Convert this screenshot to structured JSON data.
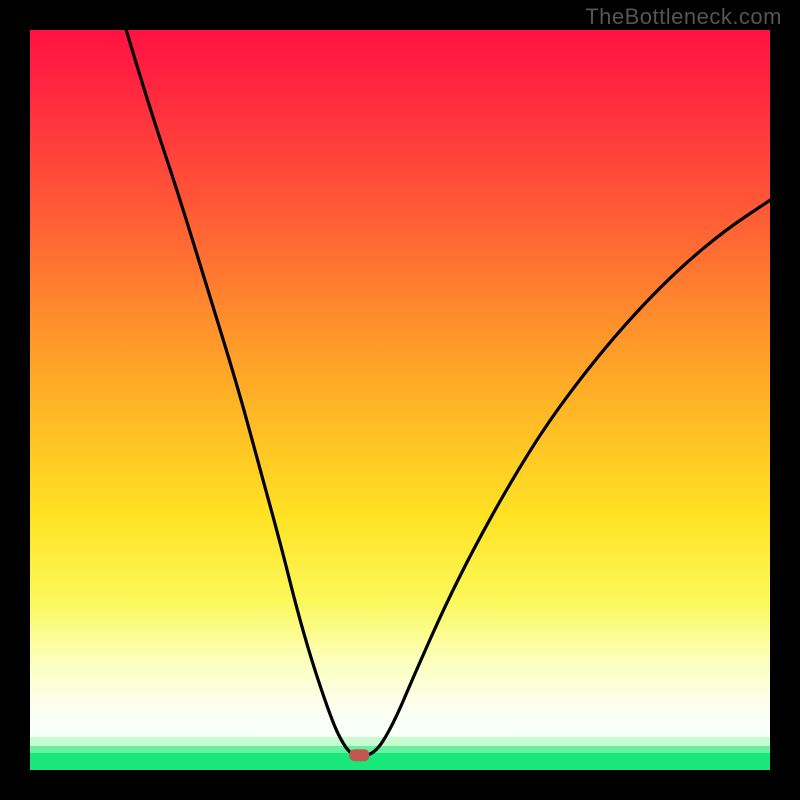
{
  "watermark": "TheBottleneck.com",
  "colors": {
    "frame_bg": "#000000",
    "curve": "#000000",
    "marker": "#c0584e",
    "gradient_top": "#ff1242",
    "gradient_mid": "#ffe223",
    "gradient_green": "#17e879"
  },
  "chart_data": {
    "type": "line",
    "title": "",
    "xlabel": "",
    "ylabel": "",
    "xlim": [
      0,
      100
    ],
    "ylim": [
      0,
      100
    ],
    "grid": false,
    "legend": false,
    "annotations": [
      "TheBottleneck.com"
    ],
    "marker": {
      "x": 44.5,
      "y": 2.0
    },
    "series": [
      {
        "name": "left-branch",
        "x": [
          13,
          16,
          20,
          24,
          28,
          31,
          34,
          36,
          38,
          40,
          41.5,
          43,
          44
        ],
        "y": [
          100,
          90,
          78,
          65,
          52,
          41,
          30,
          22,
          15,
          9,
          5,
          2.5,
          2.0
        ]
      },
      {
        "name": "valley-floor",
        "x": [
          44,
          46.5
        ],
        "y": [
          2.0,
          2.0
        ]
      },
      {
        "name": "right-branch",
        "x": [
          46.5,
          49,
          52,
          56,
          60,
          65,
          70,
          76,
          82,
          88,
          94,
          100
        ],
        "y": [
          2.0,
          6,
          13,
          22,
          30,
          39,
          47,
          55,
          62,
          68,
          73,
          77
        ]
      }
    ],
    "background_bands": [
      {
        "from_y": 100,
        "to_y": 4.5,
        "type": "gradient",
        "top_color": "#ff1242",
        "bottom_color": "#fcffe8"
      },
      {
        "from_y": 4.5,
        "to_y": 3.3,
        "color": "#c7fccf"
      },
      {
        "from_y": 3.3,
        "to_y": 2.3,
        "color": "#66f0a0"
      },
      {
        "from_y": 2.3,
        "to_y": 0.0,
        "color": "#17e879"
      }
    ]
  }
}
